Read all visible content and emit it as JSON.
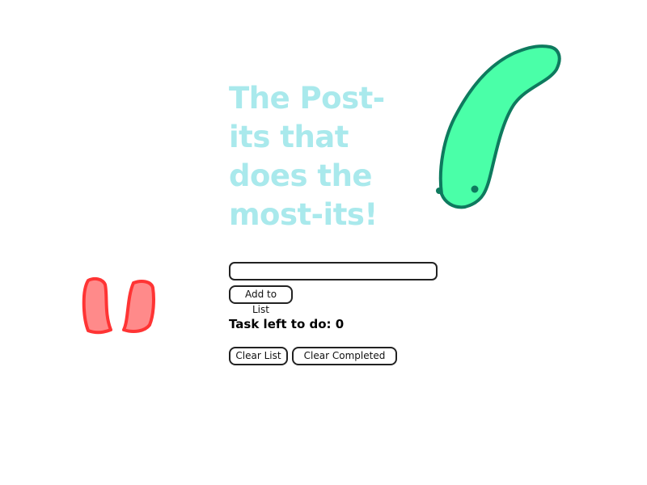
{
  "app": {
    "title": "The Post-its that does the most-its!"
  },
  "form": {
    "input_value": "",
    "add_label": "Add to List"
  },
  "status": {
    "tasks_left_text": "Task left to do: 0"
  },
  "actions": {
    "clear_list_label": "Clear List",
    "clear_completed_label": "Clear Completed"
  },
  "decorations": {
    "worm_icon": "green-worm-doodle",
    "ears_icon": "red-ears-doodle"
  },
  "colors": {
    "title": "#a9e9ec",
    "worm_fill": "#4affa8",
    "worm_stroke": "#0e7a5e",
    "ears_fill": "#ff8a8a",
    "ears_stroke": "#ff3434"
  }
}
